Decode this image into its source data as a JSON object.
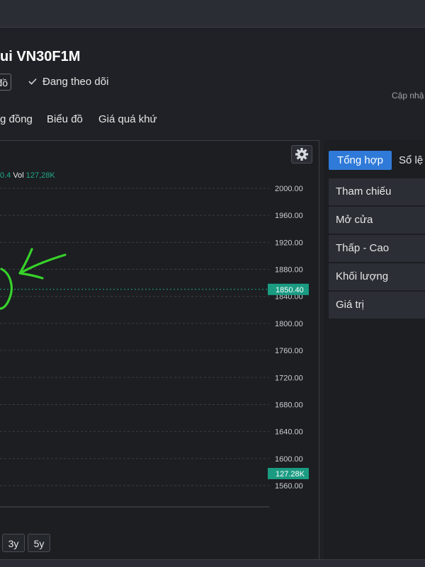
{
  "title": "ui VN30F1M",
  "subheader": {
    "button_fragment": "đồ",
    "follow_label": "Đang theo dõi",
    "updated_label": "Cập nhậ"
  },
  "tabs": [
    {
      "label": "g đồng"
    },
    {
      "label": "Biểu đồ"
    },
    {
      "label": "Giá quá khứ"
    }
  ],
  "chart": {
    "vol_prefix_value": "0.4",
    "vol_label": "Vol",
    "vol_value": "127,28K"
  },
  "right_panel": {
    "tabs": [
      {
        "label": "Tổng hợp",
        "active": true
      },
      {
        "label": "Sổ lệ",
        "active": false
      }
    ],
    "rows": [
      {
        "label": "Tham chiếu"
      },
      {
        "label": "Mở cửa"
      },
      {
        "label": "Thấp - Cao"
      },
      {
        "label": "Khối lượng"
      },
      {
        "label": "Giá trị"
      }
    ]
  },
  "range_buttons": [
    {
      "label": "3y"
    },
    {
      "label": "5y"
    }
  ],
  "colors": {
    "accent_blue": "#2f7ad8",
    "teal": "#1fa98b",
    "annotation_green": "#37d22a",
    "background": "#1f2126"
  },
  "chart_data": {
    "type": "line",
    "y_ticks": [
      "2000.00",
      "1960.00",
      "1920.00",
      "1880.00",
      "1840.00",
      "1800.00",
      "1760.00",
      "1720.00",
      "1680.00",
      "1640.00",
      "1600.00",
      "1560.00"
    ],
    "ylim": [
      1560,
      2000
    ],
    "last_price": "1850.40",
    "last_price_value": 1850.4,
    "volume_marker": "127.28K",
    "grid": true
  }
}
